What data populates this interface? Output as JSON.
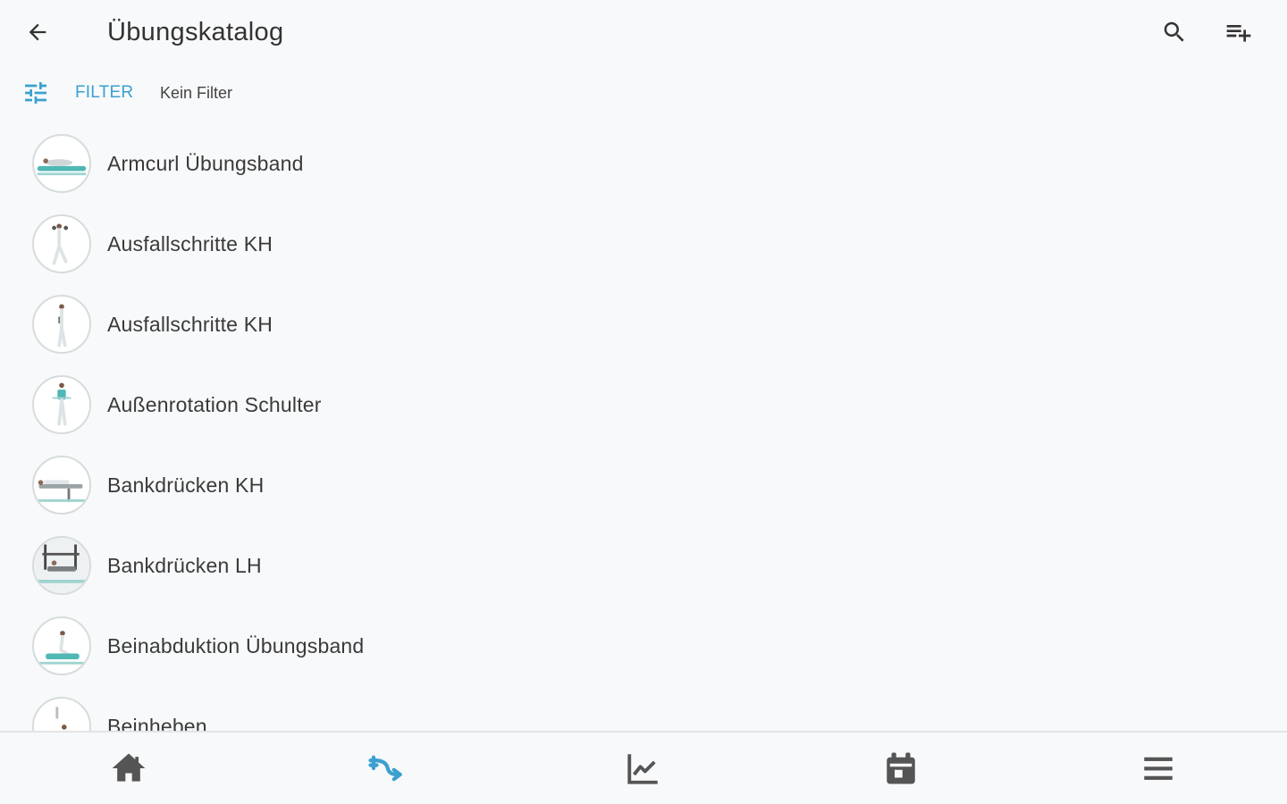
{
  "header": {
    "back_icon": "arrow-left-icon",
    "title": "Übungskatalog",
    "search_icon": "search-icon",
    "add_icon": "playlist-add-icon"
  },
  "filter": {
    "icon": "tune-icon",
    "label": "FILTER",
    "status": "Kein Filter",
    "accent_color": "#3aa0d0"
  },
  "exercises": [
    {
      "label": "Armcurl Übungsband"
    },
    {
      "label": "Ausfallschritte KH"
    },
    {
      "label": "Ausfallschritte KH"
    },
    {
      "label": "Außenrotation Schulter"
    },
    {
      "label": "Bankdrücken KH"
    },
    {
      "label": "Bankdrücken LH"
    },
    {
      "label": "Beinabduktion Übungsband"
    },
    {
      "label": "Beinheben"
    }
  ],
  "bottom_nav": [
    {
      "icon": "home-icon",
      "active": false
    },
    {
      "icon": "exercise-icon",
      "active": true
    },
    {
      "icon": "chart-icon",
      "active": false
    },
    {
      "icon": "calendar-icon",
      "active": false
    },
    {
      "icon": "menu-icon",
      "active": false
    }
  ],
  "colors": {
    "background": "#f8f9fa",
    "accent": "#3aa0d0",
    "icon": "#555555",
    "text": "#333333"
  }
}
